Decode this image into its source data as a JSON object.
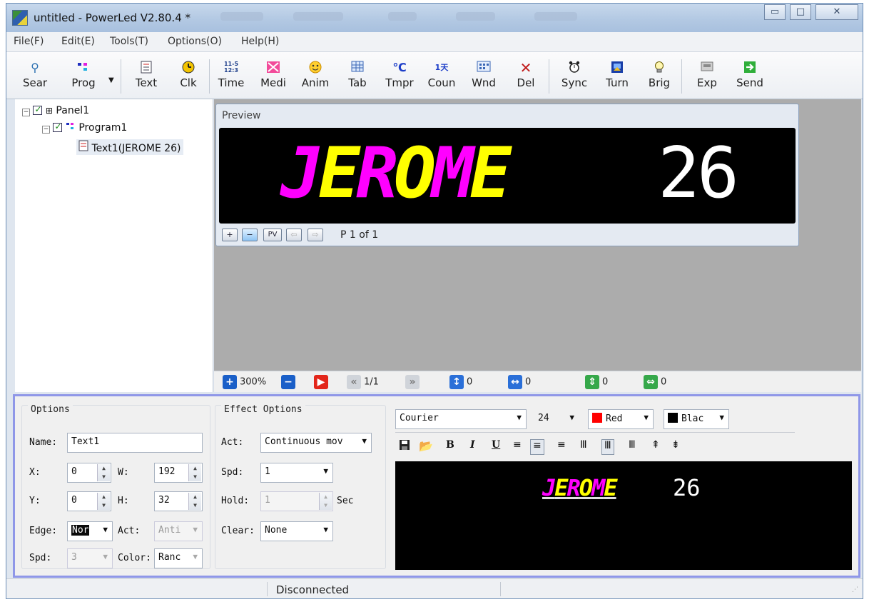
{
  "window": {
    "title": "untitled - PowerLed V2.80.4 *",
    "btn_min": "▭",
    "btn_max": "□",
    "btn_close": "✕"
  },
  "menu": [
    "File(F)",
    "Edit(E)",
    "Tools(T)",
    "Options(O)",
    "Help(H)"
  ],
  "toolbar": [
    {
      "label": "Sear",
      "icon": "search-icon"
    },
    {
      "label": "Prog",
      "icon": "program-icon"
    },
    {
      "label": "Text",
      "icon": "text-icon"
    },
    {
      "label": "Clk",
      "icon": "clock-icon"
    },
    {
      "label": "Time",
      "icon": "time-icon",
      "glyph_top": "11-5",
      "glyph_bottom": "12:3"
    },
    {
      "label": "Medi",
      "icon": "media-icon"
    },
    {
      "label": "Anim",
      "icon": "smiley-icon"
    },
    {
      "label": "Tab",
      "icon": "table-icon"
    },
    {
      "label": "Tmpr",
      "icon": "temperature-icon",
      "glyph": "℃"
    },
    {
      "label": "Coun",
      "icon": "counter-icon",
      "glyph": "1天"
    },
    {
      "label": "Wnd",
      "icon": "window-icon"
    },
    {
      "label": "Del",
      "icon": "delete-icon",
      "glyph": "✕"
    },
    {
      "label": "Sync",
      "icon": "alarm-clock-icon"
    },
    {
      "label": "Turn",
      "icon": "turn-icon"
    },
    {
      "label": "Brig",
      "icon": "lightbulb-icon"
    },
    {
      "label": "Exp",
      "icon": "export-icon"
    },
    {
      "label": "Send",
      "icon": "send-icon"
    }
  ],
  "tree": {
    "panel": "Panel1",
    "program": "Program1",
    "text": "Text1(JEROME 26)"
  },
  "preview": {
    "title": "Preview",
    "led_text_styled": "JEROME",
    "led_text_plain": "26",
    "pv_label": "PV",
    "page": "P 1 of 1",
    "colors": {
      "magenta": "#ff00ff",
      "yellow": "#ffff00"
    }
  },
  "workbar": {
    "zoom": "300%",
    "frames": "1/1",
    "v1": "0",
    "v2": "0",
    "v3": "0",
    "v4": "0"
  },
  "options": {
    "title": "Options",
    "name_label": "Name:",
    "name_value": "Text1",
    "x_label": "X:",
    "x_value": "0",
    "w_label": "W:",
    "w_value": "192",
    "y_label": "Y:",
    "y_value": "0",
    "h_label": "H:",
    "h_value": "32",
    "edge_label": "Edge:",
    "edge_value": "Nor",
    "act_label": "Act:",
    "act_value": "Anti",
    "spd_label": "Spd:",
    "spd_value": "3",
    "color_label": "Color:",
    "color_value": "Ranc"
  },
  "effects": {
    "title": "Effect Options",
    "act_label": "Act:",
    "act_value": "Continuous mov",
    "spd_label": "Spd:",
    "spd_value": "1",
    "hold_label": "Hold:",
    "hold_value": "1",
    "hold_unit": "Sec",
    "clear_label": "Clear:",
    "clear_value": "None"
  },
  "font": {
    "family": "Courier",
    "size": "24",
    "fg_color_name": "Red",
    "fg_color": "#ff0000",
    "bg_color_name": "Blac",
    "bg_color": "#000000"
  },
  "editor": {
    "text_styled": "JEROME",
    "text_plain": "26"
  },
  "status": {
    "message": "Disconnected"
  }
}
